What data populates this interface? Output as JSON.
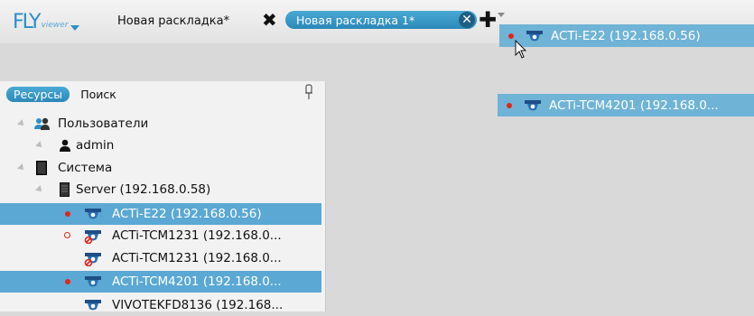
{
  "toolbar": {
    "logo_text": "FLY",
    "logo_sub": "viewer",
    "tabs": [
      {
        "label": "Новая раскладка*",
        "active": false
      },
      {
        "label": "Новая раскладка 1*",
        "active": true
      }
    ]
  },
  "drag_items": [
    {
      "label": "ACTi-E22 (192.168.0.56)"
    },
    {
      "label": "ACTi-TCM4201 (192.168.0..."
    }
  ],
  "panel": {
    "tabs": {
      "resources": "Ресурсы",
      "search": "Поиск"
    },
    "tree": [
      {
        "label": "Пользователи",
        "icon": "users-icon"
      },
      {
        "label": "admin",
        "icon": "user-icon"
      },
      {
        "label": "Система",
        "icon": "system-icon"
      },
      {
        "label": "Server (192.168.0.58)",
        "icon": "server-icon"
      },
      {
        "label": "ACTi-E22 (192.168.0.56)",
        "icon": "camera-icon",
        "status": "recording",
        "selected": true
      },
      {
        "label": "ACTi-TCM1231 (192.168.0...",
        "icon": "camera-offline-icon",
        "status": "ring"
      },
      {
        "label": "ACTi-TCM1231 (192.168.0...",
        "icon": "camera-offline-icon"
      },
      {
        "label": "ACTi-TCM4201 (192.168.0...",
        "icon": "camera-icon",
        "status": "recording",
        "selected": true
      },
      {
        "label": "VIVOTEKFD8136 (192.168...",
        "icon": "camera-icon"
      }
    ]
  },
  "colors": {
    "accent": "#2b88b8",
    "selection": "#5aa8d3",
    "recording": "#e1261c"
  }
}
